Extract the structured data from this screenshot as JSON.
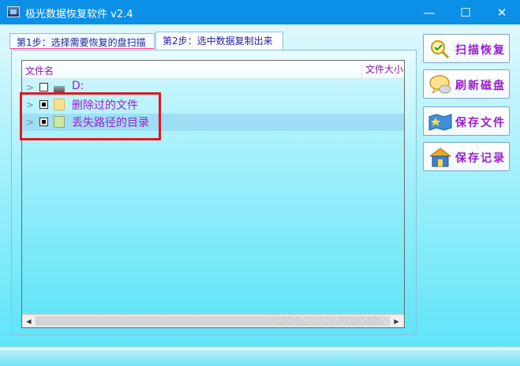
{
  "window": {
    "title": "极光数据恢复软件 v2.4",
    "minimize_glyph": "—",
    "maximize_glyph": "☐",
    "close_glyph": "✕"
  },
  "tabs": [
    {
      "label": "第1步：选择需要恢复的盘扫描"
    },
    {
      "label": "第2步：选中数据复制出来",
      "active": true
    }
  ],
  "tree": {
    "columns": {
      "name": "文件名",
      "size": "文件大小"
    },
    "rows": [
      {
        "label": "D:",
        "checked": false,
        "icon": "drive-icon"
      },
      {
        "label": "删除过的文件",
        "checked": true,
        "icon": "folder-icon"
      },
      {
        "label": "丢失路径的目录",
        "checked": true,
        "icon": "book-icon",
        "selected": true
      }
    ],
    "scroll_left_glyph": "◀",
    "scroll_right_glyph": "▶"
  },
  "actions": [
    {
      "label": "扫描恢复",
      "icon": "magnifier-icon"
    },
    {
      "label": "刷新磁盘",
      "icon": "chat-bubble-icon"
    },
    {
      "label": "保存文件",
      "icon": "save-map-icon"
    },
    {
      "label": "保存记录",
      "icon": "house-icon"
    }
  ],
  "colors": {
    "titlebar": "#0c8fe6",
    "accent_text": "#9c1bd4",
    "highlight": "#e8141b"
  }
}
